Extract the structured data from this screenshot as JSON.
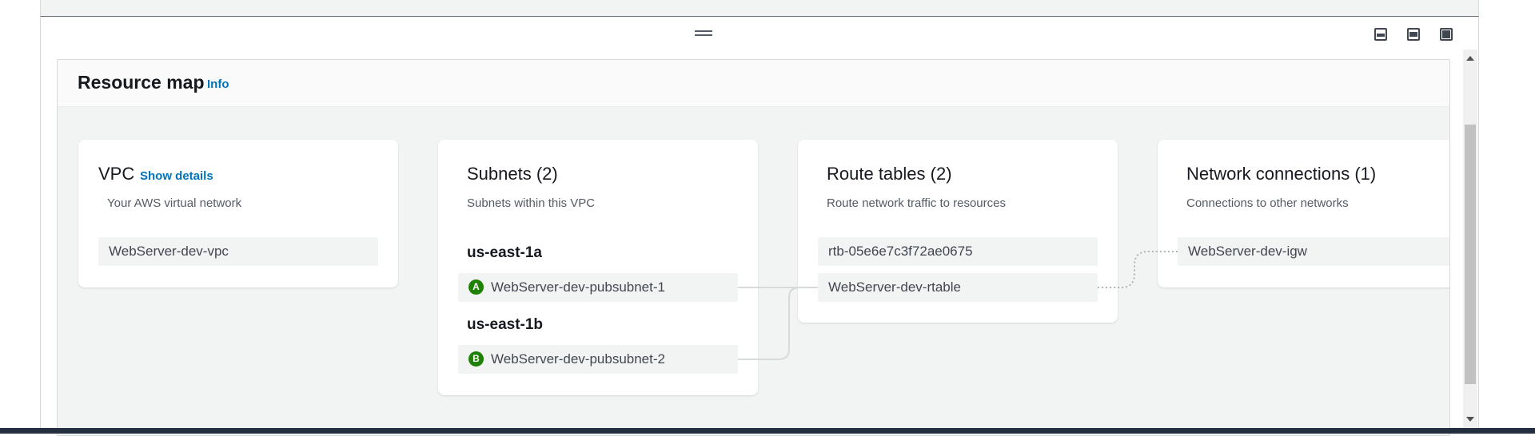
{
  "resource_map": {
    "title": "Resource map",
    "info_label": "Info"
  },
  "vpc": {
    "title": "VPC",
    "show_details": "Show details",
    "subtitle": "Your AWS virtual network",
    "items": [
      "WebServer-dev-vpc"
    ]
  },
  "subnets": {
    "title": "Subnets (2)",
    "subtitle": "Subnets within this VPC",
    "zones": [
      {
        "name": "us-east-1a",
        "badge": "A",
        "subnet": "WebServer-dev-pubsubnet-1"
      },
      {
        "name": "us-east-1b",
        "badge": "B",
        "subnet": "WebServer-dev-pubsubnet-2"
      }
    ]
  },
  "route_tables": {
    "title": "Route tables (2)",
    "subtitle": "Route network traffic to resources",
    "items": [
      "rtb-05e6e7c3f72ae0675",
      "WebServer-dev-rtable"
    ]
  },
  "network_connections": {
    "title": "Network connections (1)",
    "subtitle": "Connections to other networks",
    "items": [
      "WebServer-dev-igw"
    ]
  },
  "colors": {
    "link": "#0073bb",
    "az_badge": "#1d8102",
    "container_bg": "#f2f3f3"
  }
}
